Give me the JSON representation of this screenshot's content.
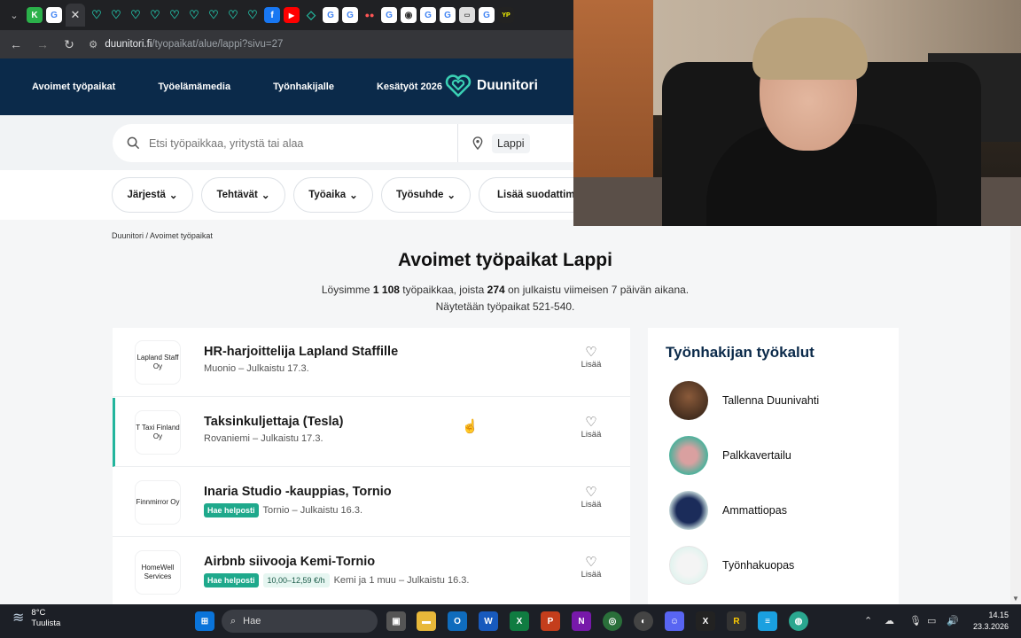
{
  "browser": {
    "url_host": "duunitori.fi",
    "url_path": "/tyopaikat/alue/lappi?sivu=27"
  },
  "nav": {
    "links": [
      "Avoimet työpaikat",
      "Työelämämedia",
      "Työnhakijalle",
      "Kesätyöt 2026"
    ],
    "logo": "Duunitori"
  },
  "search": {
    "placeholder": "Etsi työpaikkaa, yritystä tai alaa",
    "location": "Lappi"
  },
  "filters": [
    "Järjestä",
    "Tehtävät",
    "Työaika",
    "Työsuhde",
    "Lisää suodattimia"
  ],
  "breadcrumb": "Duunitori / Avoimet työpaikat",
  "page": {
    "title": "Avoimet työpaikat Lappi",
    "summary_pre": "Löysimme ",
    "summary_count": "1 108",
    "summary_mid": " työpaikkaa, joista ",
    "summary_recent": "274",
    "summary_post": " on julkaistu viimeisen 7 päivän aikana.",
    "showing": "Näytetään työpaikat 521-540."
  },
  "jobs": [
    {
      "company": "Lapland Staff Oy",
      "title": "HR-harjoittelija Lapland Staffille",
      "meta": "Muonio – Julkaistu 17.3.",
      "badge": "",
      "salary": "",
      "save": "Lisää"
    },
    {
      "company": "T Taxi Finland Oy",
      "title": "Taksinkuljettaja (Tesla)",
      "meta": "Rovaniemi – Julkaistu 17.3.",
      "badge": "",
      "salary": "",
      "save": "Lisää"
    },
    {
      "company": "Finnmirror Oy",
      "title": "Inaria Studio -kauppias, Tornio",
      "meta": "Tornio – Julkaistu 16.3.",
      "badge": "Hae helposti",
      "salary": "",
      "save": "Lisää"
    },
    {
      "company": "HomeWell Services",
      "title": "Airbnb siivooja Kemi-Tornio",
      "meta": "Kemi ja 1 muu – Julkaistu 16.3.",
      "badge": "Hae helposti",
      "salary": "10,00–12,59 €/h",
      "save": "Lisää"
    }
  ],
  "tools": {
    "title": "Työnhakijan työkalut",
    "items": [
      "Tallenna Duunivahti",
      "Palkkavertailu",
      "Ammattiopas",
      "Työnhakuopas"
    ]
  },
  "taskbar": {
    "temp": "8°C",
    "weather": "Tuulista",
    "search": "Hae",
    "time": "14.15",
    "date": "23.3.2026"
  },
  "colors": {
    "nav_bg": "#0b2a4a",
    "accent": "#23b59d",
    "badge": "#1fa98c"
  }
}
